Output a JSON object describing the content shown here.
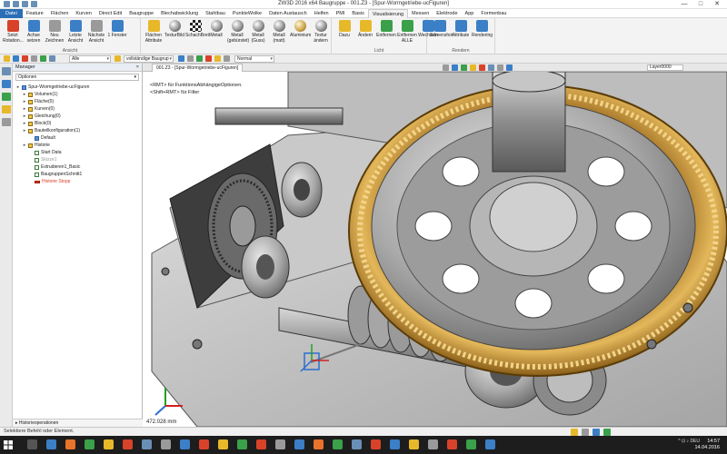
{
  "window": {
    "title": "ZW3D 2016 x64    Baugruppe - 001.Z3 - [Spur-Wormgetriebe-ucFiguren]",
    "controls": [
      "—",
      "□",
      "✕"
    ]
  },
  "ribbon_tabs": [
    "Datei",
    "Feature",
    "Flächen",
    "Kurven",
    "Direct Edit",
    "Baugruppe",
    "Blechabwicklung",
    "Stahlbau",
    "PunkteWolke",
    "Daten Austausch",
    "Helfen",
    "PMI",
    "Basis",
    "Visualisierung",
    "Messen",
    "Elektrode",
    "App",
    "Formenbau"
  ],
  "active_tab": "Visualisierung",
  "ribbon": {
    "groups": [
      {
        "label": "Ansicht",
        "buttons": [
          "Setzt Rotation...",
          "Achse setzen",
          "Neu Zeichnen",
          "Letzte Ansicht",
          "Nächste Ansicht",
          "1 Fenster"
        ]
      },
      {
        "label": "",
        "buttons": [
          "Flächen Attribute",
          "TexturBild",
          "SchachBrett",
          "Metall",
          "Metall (gebürstet)",
          "Metall (Guss)",
          "Metall (matt)",
          "Aluminium",
          "Textur ändern"
        ]
      },
      {
        "label": "Licht",
        "buttons": [
          "Dazu",
          "Ändern",
          "Entfernen",
          "Entfernen ALLE",
          "Wechseln"
        ]
      },
      {
        "label": "Rendern",
        "buttons": [
          "Screenshot",
          "Attribute",
          "Rendering"
        ]
      }
    ]
  },
  "toolbar": {
    "filter": "Alle",
    "mode": "vollständige Baugrup",
    "normal": "Normal"
  },
  "manager": {
    "title": "Manager",
    "close": "×",
    "option": "Optionen",
    "tree": [
      {
        "label": "Spur-Wormgetriebe-ucFiguren",
        "indent": 0,
        "icon": "doc"
      },
      {
        "label": "Volumen(1)",
        "indent": 1,
        "icon": "folder"
      },
      {
        "label": "Fläche(0)",
        "indent": 1,
        "icon": "folder"
      },
      {
        "label": "Kurven(0)",
        "indent": 1,
        "icon": "folder"
      },
      {
        "label": "Gleichung(0)",
        "indent": 1,
        "icon": "folder"
      },
      {
        "label": "Block(0)",
        "indent": 1,
        "icon": "folder"
      },
      {
        "label": "Bauteilkonfiguration(1)",
        "indent": 1,
        "icon": "folder"
      },
      {
        "label": "Default",
        "indent": 2,
        "icon": "doc"
      },
      {
        "label": "Historie",
        "indent": 1,
        "icon": "folder"
      },
      {
        "label": "Start Data",
        "indent": 2,
        "icon": "chk"
      },
      {
        "label": "Skizze1",
        "indent": 2,
        "icon": "chk"
      },
      {
        "label": "Extrudieren1_Basic",
        "indent": 2,
        "icon": "chk"
      },
      {
        "label": "BaugruppenSchnitt1",
        "indent": 2,
        "icon": "chk"
      },
      {
        "label": "Historie Stopp",
        "indent": 2,
        "icon": "red"
      }
    ],
    "bottom": "Historieoperationen"
  },
  "viewport": {
    "tab": "001.Z3 - [Spur-Wormgetriebe-ucFiguren]",
    "layer": "Layer0000",
    "hint1": "<RMT> für FunktionsAbhängigeOptionen.",
    "hint2": "<Shift+RMT> für Filter",
    "measure": "472.028 mm"
  },
  "status": {
    "text": "Selektiere Befehl oder Element."
  },
  "taskbar": {
    "tray": "^ ⊡ ♪ DEU",
    "time": "14:57",
    "date": "14.04.2016"
  },
  "colors": {
    "file_tab": "#2a6fb5",
    "gear_bronze": "#c99a3a",
    "taskbar": "#1d1d1d"
  }
}
